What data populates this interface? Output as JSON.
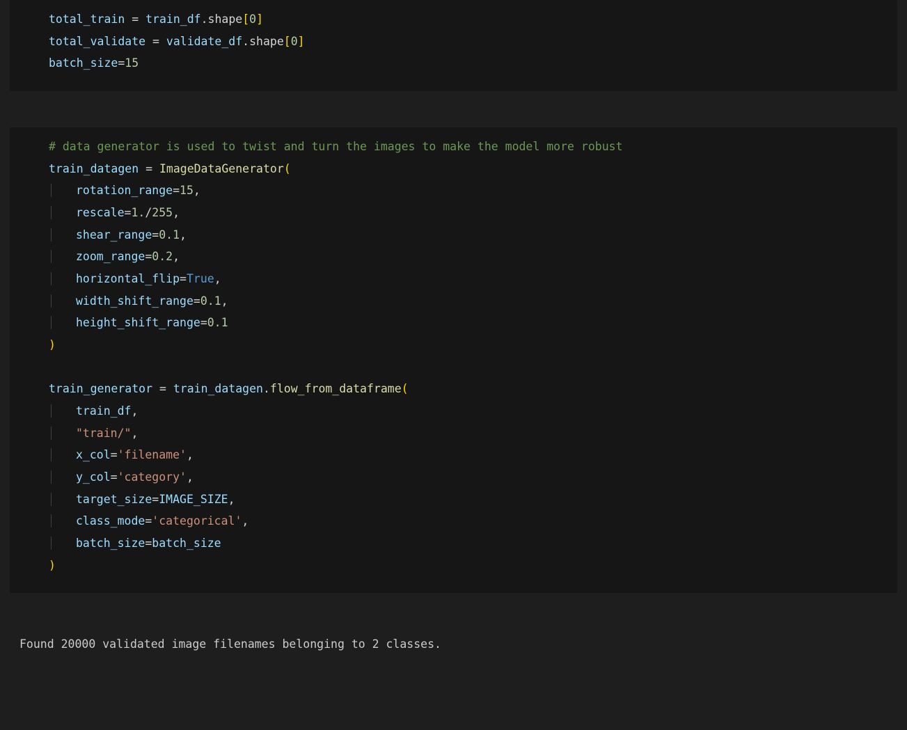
{
  "cell1": {
    "total_train_var": "total_train",
    "train_df": "train_df",
    "shape_attr": "shape",
    "zero": "0",
    "total_validate_var": "total_validate",
    "validate_df": "validate_df",
    "batch_size_var": "batch_size",
    "batch_size_val": "15"
  },
  "cell2": {
    "comment": "# data generator is used to twist and turn the images to make the model more robust",
    "train_datagen_var": "train_datagen",
    "ImageDataGenerator": "ImageDataGenerator",
    "rotation_range_kw": "rotation_range",
    "rotation_range_val": "15",
    "rescale_kw": "rescale",
    "rescale_val_a": "1.",
    "rescale_val_b": "255",
    "shear_range_kw": "shear_range",
    "shear_range_val": "0.1",
    "zoom_range_kw": "zoom_range",
    "zoom_range_val": "0.2",
    "horizontal_flip_kw": "horizontal_flip",
    "true_const": "True",
    "width_shift_range_kw": "width_shift_range",
    "width_shift_range_val": "0.1",
    "height_shift_range_kw": "height_shift_range",
    "height_shift_range_val": "0.1",
    "train_generator_var": "train_generator",
    "flow_from_dataframe": "flow_from_dataframe",
    "train_df_arg": "train_df",
    "train_path_str": "\"train/\"",
    "x_col_kw": "x_col",
    "x_col_val": "'filename'",
    "y_col_kw": "y_col",
    "y_col_val": "'category'",
    "target_size_kw": "target_size",
    "IMAGE_SIZE": "IMAGE_SIZE",
    "class_mode_kw": "class_mode",
    "class_mode_val": "'categorical'",
    "batch_size_kw": "batch_size",
    "batch_size_arg": "batch_size"
  },
  "output": {
    "text": "Found 20000 validated image filenames belonging to 2 classes."
  }
}
